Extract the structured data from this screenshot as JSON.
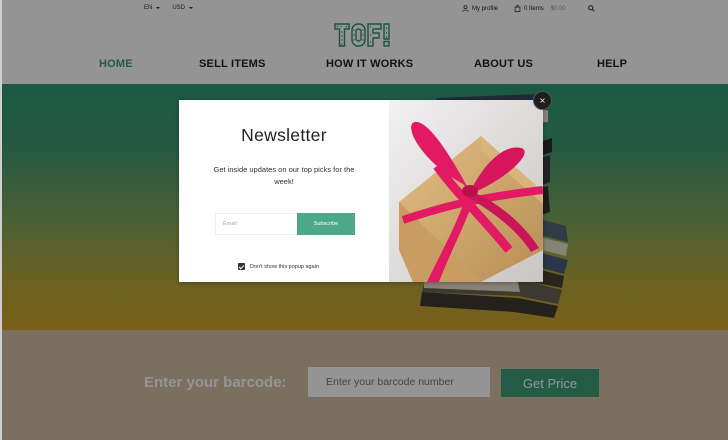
{
  "header": {
    "language": "EN",
    "currency": "USD",
    "my_profile": "My profile",
    "cart_items": "0 Items",
    "cart_total": "$0.00",
    "logo_text": "TOFI"
  },
  "nav": {
    "items": [
      "HOME",
      "SELL ITEMS",
      "HOW IT WORKS",
      "ABOUT US",
      "HELP"
    ],
    "active": "HOME"
  },
  "barcode": {
    "label": "Enter your barcode:",
    "placeholder": "Enter your barcode number",
    "button": "Get Price"
  },
  "newsletter": {
    "title": "Newsletter",
    "description": "Get inside updates on our top picks for the week!",
    "email_placeholder": "Email",
    "subscribe": "Subscribe",
    "dont_show": "Don't show this popup again",
    "dont_show_checked": true,
    "close": "×"
  },
  "colors": {
    "accent": "#3f9e7a",
    "hero_top": "#2f9a78",
    "hero_bottom": "#d3a52b",
    "barcode_bg": "#d4bfa6",
    "ribbon": "#e21a64"
  },
  "icons": {
    "profile": "user-icon",
    "cart": "bag-icon",
    "search": "search-icon",
    "close": "close-icon"
  }
}
